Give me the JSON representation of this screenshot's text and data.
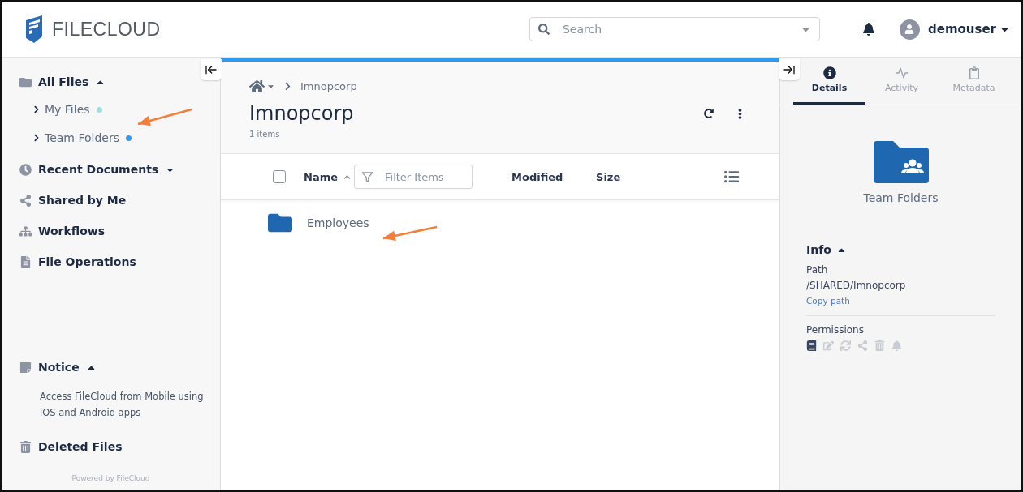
{
  "header": {
    "logo_text": "FILECLOUD",
    "search": {
      "placeholder": "Search"
    },
    "user": "demouser"
  },
  "sidebar": {
    "items": [
      {
        "label": "All Files",
        "kind": "folder",
        "expanded": true,
        "children": [
          {
            "label": "My Files",
            "color": "#9fe0e0"
          },
          {
            "label": "Team Folders",
            "color": "#2d9cf0"
          }
        ]
      },
      {
        "label": "Recent Documents",
        "kind": "clock",
        "expanded": false
      },
      {
        "label": "Shared by Me",
        "kind": "share"
      },
      {
        "label": "Workflows",
        "kind": "workflow"
      },
      {
        "label": "File Operations",
        "kind": "file"
      }
    ],
    "notice": {
      "title": "Notice",
      "expanded": true,
      "text": "Access FileCloud from Mobile using iOS and Android apps"
    },
    "deleted": "Deleted Files",
    "footer": "Powered by FileCloud"
  },
  "main": {
    "breadcrumb": [
      "Imnopcorp"
    ],
    "title": "Imnopcorp",
    "count": "1 items",
    "select_all": {
      "checked": false
    },
    "columns": [
      {
        "label": "Name",
        "sorted": true
      },
      {
        "label": "Modified",
        "sorted": false
      },
      {
        "label": "Size",
        "sorted": false
      }
    ],
    "filter": {
      "placeholder": "Filter Items"
    },
    "rows": [
      {
        "name": "Employees"
      }
    ]
  },
  "details": {
    "tabs": [
      {
        "label": "Details",
        "kind": "info",
        "selected": true
      },
      {
        "label": "Activity",
        "kind": "activity",
        "selected": false
      },
      {
        "label": "Metadata",
        "kind": "metadata",
        "selected": false
      }
    ],
    "folder_name": "Team Folders",
    "info_title": "Info",
    "info_expanded": true,
    "path_label": "Path",
    "path": "/SHARED/Imnopcorp",
    "copy_link": "Copy path",
    "permissions_title": "Permissions",
    "permissions": [
      {
        "kind": "read",
        "enabled": true
      },
      {
        "kind": "write",
        "enabled": false
      },
      {
        "kind": "sync",
        "enabled": false
      },
      {
        "kind": "share",
        "enabled": false
      },
      {
        "kind": "delete",
        "enabled": false
      },
      {
        "kind": "notify",
        "enabled": false
      }
    ]
  }
}
